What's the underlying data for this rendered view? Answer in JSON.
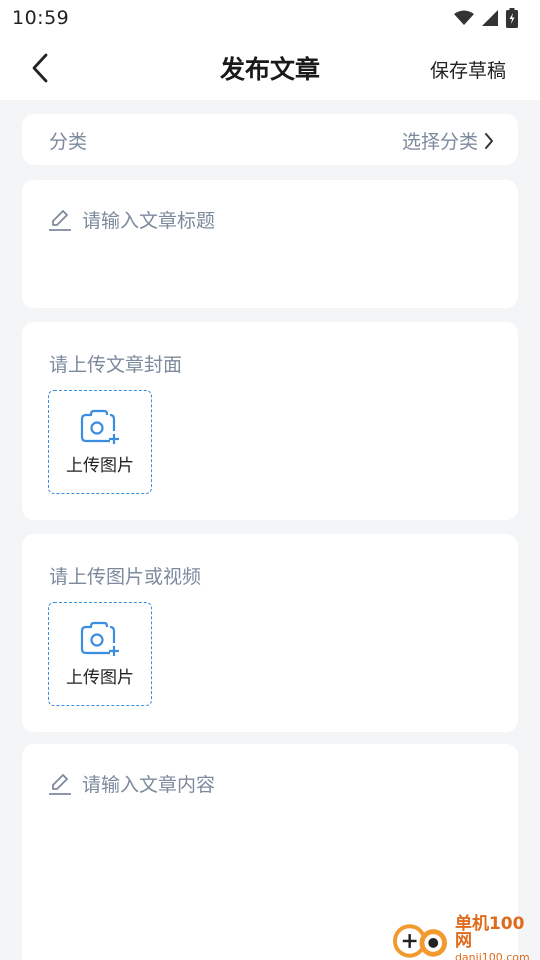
{
  "status_bar": {
    "time": "10:59"
  },
  "nav": {
    "title": "发布文章",
    "save_draft": "保存草稿"
  },
  "category": {
    "label": "分类",
    "select": "选择分类"
  },
  "title_field": {
    "placeholder": "请输入文章标题"
  },
  "cover": {
    "label": "请上传文章封面",
    "upload_label": "上传图片"
  },
  "media": {
    "label": "请上传图片或视频",
    "upload_label": "上传图片"
  },
  "content_field": {
    "placeholder": "请输入文章内容"
  },
  "watermark": {
    "name": "单机100网",
    "url": "danji100.com"
  },
  "colors": {
    "accent": "#3a8de0",
    "hint": "#7d8a9e",
    "background": "#f4f5f7",
    "watermark": "#e06a1b"
  }
}
